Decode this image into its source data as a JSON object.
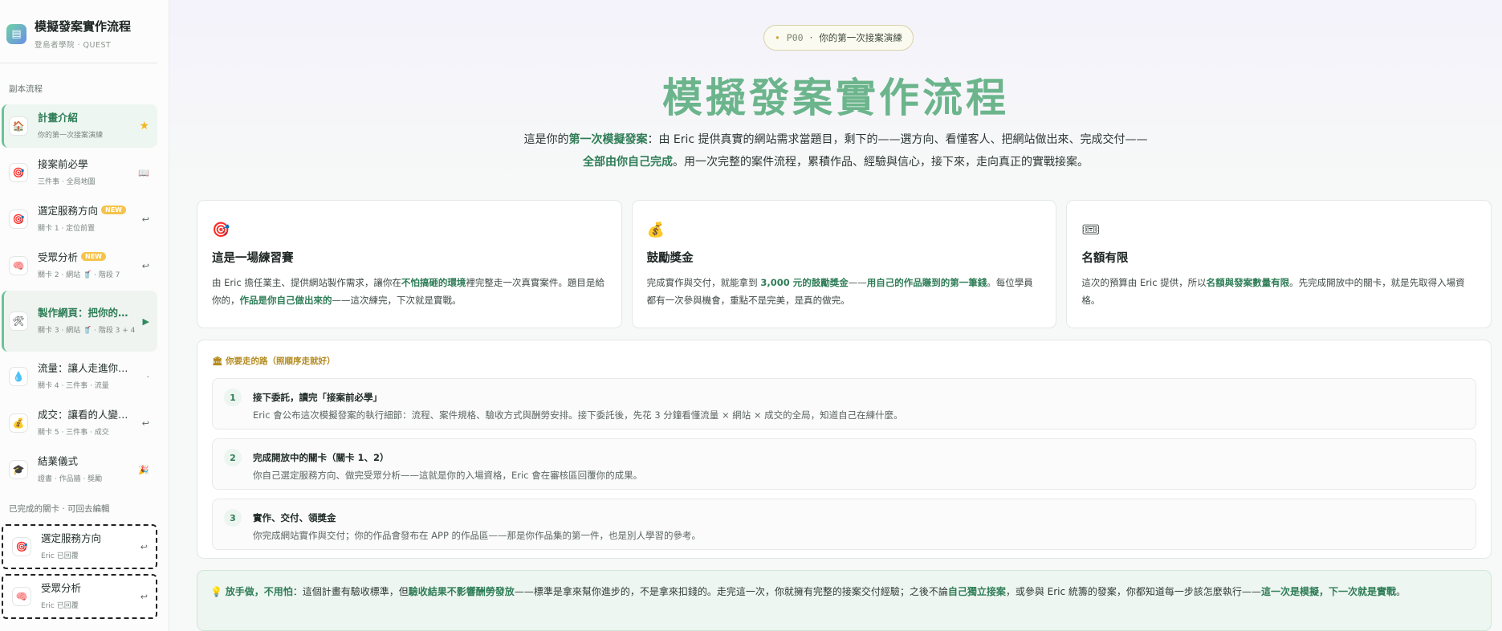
{
  "brand": {
    "icon": "book-icon",
    "title": "模擬發案實作流程",
    "subtitle": "登島者學院 · QUEST"
  },
  "sidebar": {
    "section_title": "副本流程",
    "items": [
      {
        "label": "計畫介紹",
        "sub": "你的第一次接案演練",
        "icon": "home-icon",
        "end": "★",
        "state": "active"
      },
      {
        "label": "接案前必學",
        "sub": "三件事 · 全局地圖",
        "icon": "target-icon",
        "end": "📖"
      },
      {
        "label": "選定服務方向",
        "badge": "NEW",
        "sub": "關卡 1 · 定位前置",
        "icon": "target-icon",
        "end": "↩"
      },
      {
        "label": "受眾分析",
        "badge": "NEW",
        "sub": "關卡 2 · 網站 🥤 · 階段 7",
        "icon": "brain-icon",
        "end": "↩"
      },
      {
        "label": "製作網頁：把你的…",
        "sub": "關卡 3 · 網站 🥤 · 階段 3 + 4",
        "icon": "tools-icon",
        "end": "▶",
        "state": "current"
      },
      {
        "label": "流量：讓人走進你…",
        "sub": "關卡 4 · 三件事 · 流量",
        "icon": "droplet-icon",
        "end": "·"
      },
      {
        "label": "成交：讓看的人變…",
        "sub": "關卡 5 · 三件事 · 成交",
        "icon": "money-bag-icon",
        "end": "↩"
      },
      {
        "label": "結業儀式",
        "sub": "證書 · 作品牆 · 獎勵",
        "icon": "graduation-cap-icon",
        "end": "🎉"
      }
    ],
    "done_title": "已完成的關卡 · 可回去編輯",
    "done_items": [
      {
        "label": "選定服務方向",
        "sub": "Eric 已回覆",
        "icon": "target-icon",
        "end": "↩"
      },
      {
        "label": "受眾分析",
        "sub": "Eric 已回覆",
        "icon": "brain-icon",
        "end": "↩"
      }
    ]
  },
  "hero": {
    "pill_dot": "•",
    "pill_code": "P00",
    "pill_sep": "·",
    "pill_text": "你的第一次接案演練",
    "title": "模擬發案實作流程",
    "desc": [
      {
        "t": "這是你的"
      },
      {
        "t": "第一次模擬發案",
        "b": true
      },
      {
        "t": "：由 Eric 提供真實的網站需求當題目，剩下的——選方向、看懂客人、把網站做出來、完成交付——"
      },
      {
        "t": "全部由你自己完成",
        "b": true
      },
      {
        "t": "。用一次完整的案件流程，累積作品、經驗與信心，接下來，走向真正的實戰接案。"
      }
    ]
  },
  "cards": [
    {
      "icon": "🎯",
      "icon_name": "target-icon",
      "title": "這是一場練習賽",
      "desc": [
        {
          "t": "由 Eric 擔任業主、提供網站製作需求，讓你在"
        },
        {
          "t": "不怕搞砸的環境",
          "b": true
        },
        {
          "t": "裡完整走一次真實案件。題目是給你的，"
        },
        {
          "t": "作品是你自己做出來的",
          "b": true
        },
        {
          "t": "——這次練完，下次就是實戰。"
        }
      ]
    },
    {
      "icon": "💰",
      "icon_name": "money-bag-icon",
      "title": "鼓勵獎金",
      "desc": [
        {
          "t": "完成實作與交付，就能拿到 "
        },
        {
          "t": "3,000 元的鼓勵獎金",
          "b": true
        },
        {
          "t": "——"
        },
        {
          "t": "用自己的作品賺到的第一筆錢",
          "b": true
        },
        {
          "t": "。每位學員都有一次參與機會，重點不是完美，是真的做完。"
        }
      ]
    },
    {
      "icon": "🎟",
      "icon_name": "ticket-icon",
      "title": "名額有限",
      "desc": [
        {
          "t": "這次的預算由 Eric 提供，所以"
        },
        {
          "t": "名額與發案數量有限",
          "b": true
        },
        {
          "t": "。先完成開放中的關卡，就是先取得入場資格。"
        }
      ]
    }
  ],
  "path": {
    "title_icon": "🏛",
    "title": "你要走的路（照順序走就好）",
    "steps": [
      {
        "num": "1",
        "title": "接下委託，讀完「接案前必學」",
        "desc": "Eric 會公布這次模擬發案的執行細節：流程、案件規格、驗收方式與酬勞安排。接下委託後，先花 3 分鐘看懂流量 × 網站 × 成交的全局，知道自己在練什麼。"
      },
      {
        "num": "2",
        "title": "完成開放中的關卡（關卡 1、2）",
        "desc": "你自己選定服務方向、做完受眾分析——這就是你的入場資格，Eric 會在審核區回覆你的成果。"
      },
      {
        "num": "3",
        "title": "實作、交付、領獎金",
        "desc": "你完成網站實作與交付；你的作品會發布在 APP 的作品區——那是你作品集的第一件，也是別人學習的參考。"
      }
    ]
  },
  "note": {
    "icon": "💡",
    "parts": [
      {
        "t": "放手做，不用怕",
        "b": true
      },
      {
        "t": "：這個計畫有驗收標準，但"
      },
      {
        "t": "驗收結果不影響酬勞發放",
        "b": true
      },
      {
        "t": "——標準是拿來幫你進步的，不是拿來扣錢的。走完這一次，你就擁有完整的接案交付經驗；之後不論"
      },
      {
        "t": "自己獨立接案",
        "b": true
      },
      {
        "t": "，或參與 Eric 統籌的發案，你都知道每一步該怎麼執行——"
      },
      {
        "t": "這一次是模擬，下一次就是實戰",
        "b": true
      },
      {
        "t": "。"
      }
    ]
  },
  "colors": {
    "accent": "#2f7d57",
    "hero_title": "#6cb58c",
    "badge": "#f5c34c",
    "path_title": "#b38a1e"
  }
}
